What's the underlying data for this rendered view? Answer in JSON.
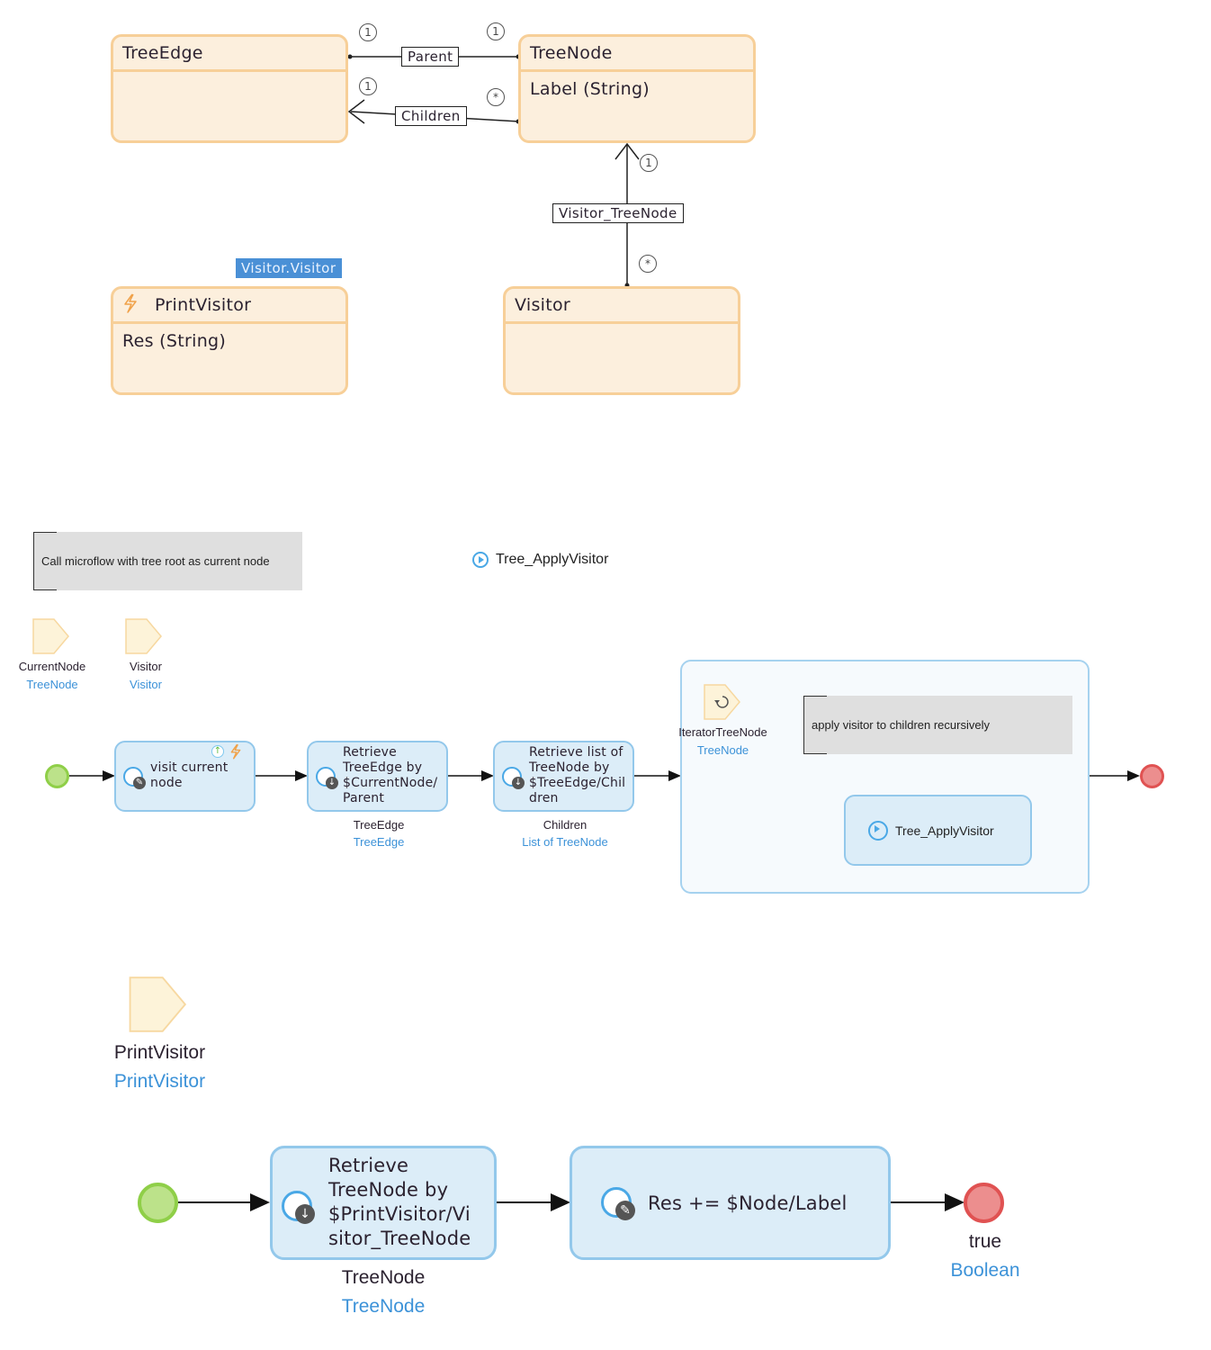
{
  "domain_model": {
    "entities": [
      {
        "name": "TreeEdge",
        "attributes": []
      },
      {
        "name": "TreeNode",
        "attributes": [
          "Label (String)"
        ]
      },
      {
        "name": "PrintVisitor",
        "attributes": [
          "Res (String)"
        ],
        "generalization": "Visitor.Visitor",
        "icon": "event-handler-icon"
      },
      {
        "name": "Visitor",
        "attributes": []
      }
    ],
    "associations": [
      {
        "name": "Parent",
        "from": "TreeEdge",
        "to": "TreeNode",
        "from_mult": "1",
        "to_mult": "1"
      },
      {
        "name": "Children",
        "from": "TreeNode",
        "to": "TreeEdge",
        "from_mult": "*",
        "to_mult": "1"
      },
      {
        "name": "Visitor_TreeNode",
        "from": "Visitor",
        "to": "TreeNode",
        "from_mult": "*",
        "to_mult": "1"
      }
    ]
  },
  "microflow1": {
    "annotation": "Call microflow with tree root as current node",
    "title": "Tree_ApplyVisitor",
    "params": [
      {
        "name": "CurrentNode",
        "type": "TreeNode"
      },
      {
        "name": "Visitor",
        "type": "Visitor"
      }
    ],
    "activities": [
      {
        "text": "visit current node"
      },
      {
        "text": "Retrieve TreeEdge by $CurrentNode/ Parent",
        "lines": [
          "Retrieve",
          "TreeEdge by",
          "$CurrentNode/",
          "Parent"
        ],
        "output_name": "TreeEdge",
        "output_type": "TreeEdge"
      },
      {
        "text": "Retrieve list of TreeNode by $TreeEdge/Children",
        "lines": [
          "Retrieve list of",
          "TreeNode by",
          "$TreeEdge/Chil",
          "dren"
        ],
        "output_name": "Children",
        "output_type": "List of TreeNode"
      }
    ],
    "loop": {
      "iterator_name": "IteratorTreeNode",
      "iterator_type": "TreeNode",
      "annotation": "apply visitor to children recursively",
      "call": "Tree_ApplyVisitor"
    }
  },
  "microflow2": {
    "param": {
      "name": "PrintVisitor",
      "type": "PrintVisitor"
    },
    "activities": [
      {
        "lines": [
          "Retrieve",
          "TreeNode by",
          "$PrintVisitor/Vi",
          "sitor_TreeNode"
        ],
        "output_name": "TreeNode",
        "output_type": "TreeNode"
      },
      {
        "text": "Res += $Node/Label"
      }
    ],
    "end": {
      "value": "true",
      "type": "Boolean"
    }
  },
  "colors": {
    "entity_fill": "#fcefdd",
    "entity_border": "#f7cf98",
    "activity_fill": "#dcedf8",
    "activity_border": "#93c8eb",
    "type_text": "#3c92d8",
    "start": "#8fcf48",
    "end": "#e05252",
    "generalization_tag": "#4a90d6"
  }
}
